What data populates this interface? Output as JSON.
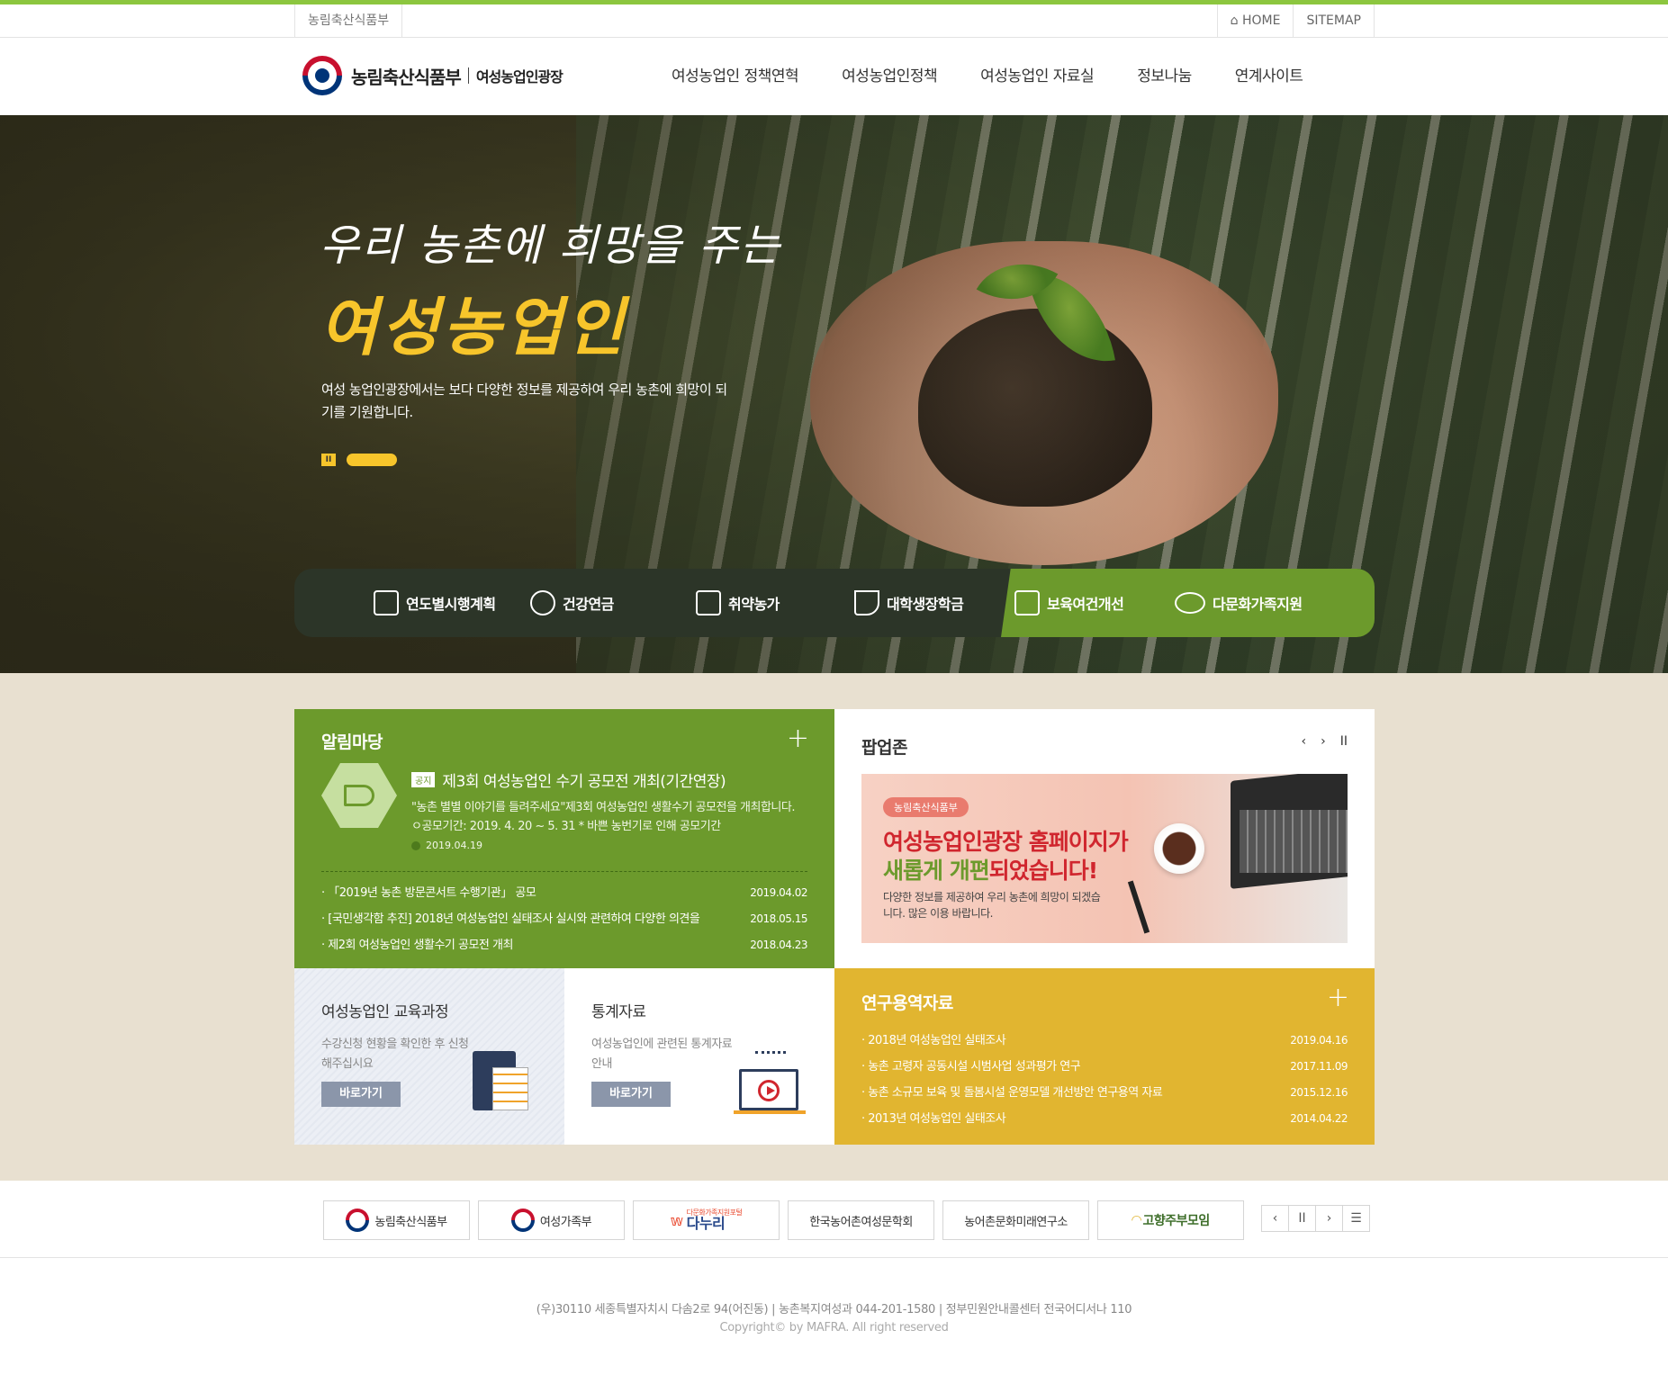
{
  "utilbar": {
    "org_label": "농림축산식품부",
    "home_label": "HOME",
    "sitemap_label": "SITEMAP"
  },
  "header": {
    "logo_main": "농림축산식품부",
    "logo_sub": "여성농업인광장",
    "nav": [
      "여성농업인 정책연혁",
      "여성농업인정책",
      "여성농업인 자료실",
      "정보나눔",
      "연계사이트"
    ]
  },
  "hero": {
    "title_line1": "우리 농촌에 희망을 주는",
    "title_line2": "여성농업인",
    "description": "여성 농업인광장에서는 보다 다양한 정보를 제공하여 우리 농촌에 희망이 되기를 기원합니다.",
    "pause_label": "II",
    "accent_color": "#f7c52b"
  },
  "quicklinks": [
    "연도별시행계획",
    "건강연금",
    "취약농가",
    "대학생장학금",
    "보육여건개선",
    "다문화가족지원"
  ],
  "notice": {
    "title": "알림마당",
    "plus_label": "+",
    "featured": {
      "tag": "공지",
      "title": "제3회 여성농업인 수기 공모전 개최(기간연장)",
      "body": "\"농촌 별별 이야기를 들려주세요\"제3회 여성농업인 생활수기 공모전을 개최합니다. ㅇ공모기간: 2019. 4. 20 ~ 5. 31 * 바쁜 농번기로 인해 공모기간",
      "date": "2019.04.19"
    },
    "items": [
      {
        "title": "「2019년 농촌 방문콘서트 수행기관」 공모",
        "date": "2019.04.02"
      },
      {
        "title": "[국민생각함 추진] 2018년 여성농업인 실태조사 실시와 관련하여 다양한 의견을",
        "date": "2018.05.15"
      },
      {
        "title": "제2회 여성농업인 생활수기 공모전 개최",
        "date": "2018.04.23"
      }
    ],
    "color": "#6c9a2c"
  },
  "popup": {
    "title": "팝업존",
    "prev_label": "‹",
    "next_label": "›",
    "pause_label": "II",
    "banner": {
      "tag": "농림축산식품부",
      "line1": "여성농업인광장 홈페이지가",
      "line2a": "새롭게 개편",
      "line2b": "되었습니다!",
      "desc": "다양한 정보를 제공하여 우리 농촌에 희망이 되겠습니다. 많은 이용 바랍니다."
    }
  },
  "education": {
    "title": "여성농업인 교육과정",
    "desc": "수강신청 현황을 확인한 후 신청해주십시요",
    "button": "바로가기"
  },
  "statistics": {
    "title": "통계자료",
    "desc": "여성농업인에 관련된 통계자료 안내",
    "button": "바로가기"
  },
  "research": {
    "title": "연구용역자료",
    "plus_label": "+",
    "items": [
      {
        "title": "2018년 여성농업인 실태조사",
        "date": "2019.04.16"
      },
      {
        "title": "농촌 고령자 공동시설 시범사업 성과평가 연구",
        "date": "2017.11.09"
      },
      {
        "title": "농촌 소규모 보육 및 돌봄시설 운영모델 개선방안 연구용역 자료",
        "date": "2015.12.16"
      },
      {
        "title": "2013년 여성농업인 실태조사",
        "date": "2014.04.22"
      }
    ],
    "color": "#e1b530"
  },
  "partners": {
    "logos": [
      "농림축산식품부",
      "여성가족부",
      "다누리",
      "한국농어촌여성문학회",
      "농어촌문화미래연구소",
      "고향주부모임"
    ],
    "danuri_small": "다문화가족지원포털",
    "ctrl_prev": "‹",
    "ctrl_pause": "II",
    "ctrl_next": "›",
    "ctrl_list": "☰"
  },
  "footer": {
    "address": "(우)30110 세종특별자치시 다솜2로 94(어진동)  |  농촌복지여성과 044-201-1580  |  정부민원안내콜센터 전국어디서나 110",
    "copyright": "Copyright© by MAFRA. All right reserved"
  }
}
